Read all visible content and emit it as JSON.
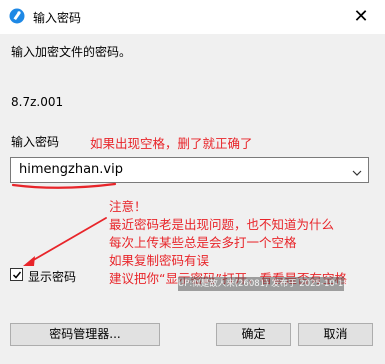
{
  "window": {
    "title": "输入密码",
    "close_symbol": "✕",
    "icon": "app-icon"
  },
  "dialog": {
    "prompt": "输入加密文件的密码。",
    "filename": "8.7z.001",
    "password_label": "输入密码",
    "password_value": "himengzhan.vip",
    "show_password_label": "显示密码",
    "show_password_checked": true,
    "buttons": {
      "manager": "密码管理器...",
      "ok": "确定",
      "cancel": "取消"
    }
  },
  "annotations": {
    "top": "如果出现空格，删了就正确了",
    "note_lines": [
      "注意！",
      "最近密码老是出现问题，也不知道为什么",
      "每次上传某些总是会多打一个空格",
      "如果复制密码有误",
      "建议把你“显示密码”打开，看看是否有空格"
    ],
    "color": "#e8252a"
  },
  "watermark": "UP:似是故人来(26081) 发布于 2025-10-18",
  "colors": {
    "dialog_bg": "#f0f0f0",
    "titlebar_bg": "#ffffff",
    "button_bg": "#e1e1e1",
    "button_border": "#adadad",
    "accent_icon": "#1e88e5"
  }
}
